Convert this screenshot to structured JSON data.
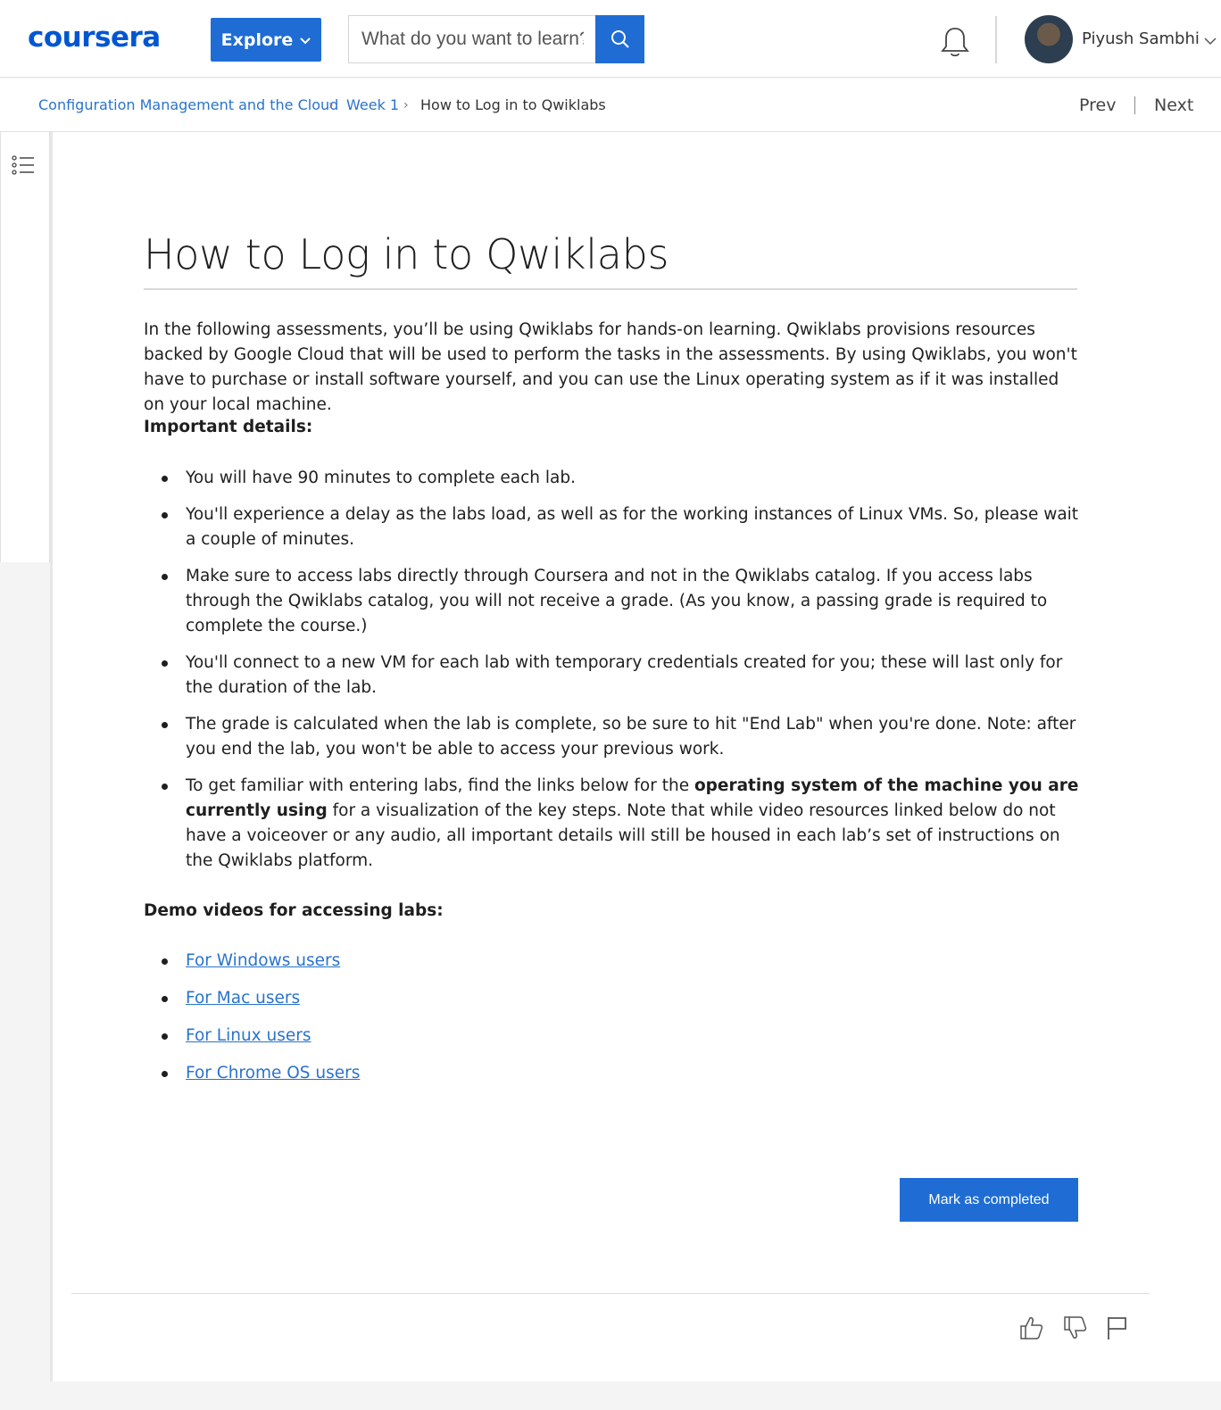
{
  "header": {
    "logo_text": "coursera",
    "explore_label": "Explore",
    "search_placeholder": "What do you want to learn?",
    "user_name": "Piyush Sambhi"
  },
  "breadcrumb": {
    "items": [
      "Configuration Management and the Cloud",
      "Week 1",
      "How to Log in to Qwiklabs"
    ],
    "prev_label": "Prev",
    "next_label": "Next"
  },
  "content": {
    "title": "How to Log in to Qwiklabs",
    "intro": "In the following assessments, you’ll be using Qwiklabs for hands-on learning. Qwiklabs provisions resources backed by Google Cloud that will be used to perform the tasks in the assessments. By using Qwiklabs, you won't have to purchase or install software yourself, and you can use the Linux operating system as if it was installed on your local machine.",
    "important_heading": "Important details:",
    "bullets": [
      "You will have 90 minutes to complete each lab.",
      "You'll experience a delay as the labs load, as well as for the working instances of Linux VMs. So, please wait a couple of minutes.",
      "Make sure to access labs directly through Coursera and not in the Qwiklabs catalog. If you access labs through the Qwiklabs catalog, you will not receive a grade. (As you know, a passing grade is required to complete the course.)",
      "You'll connect to a new VM for each lab with temporary credentials created for you; these will last only for the duration of the lab.",
      "The grade is calculated when the lab is complete, so be sure to hit \"End Lab\" when you're done. Note: after you end the lab, you won't be able to access your previous work."
    ],
    "last_bullet": {
      "before": "To get familiar with entering labs, find the links below for the ",
      "bold": "operating system of the machine you are currently using",
      "after": " for a visualization of the key steps. Note that while video resources linked below do not have a voiceover or any audio, all important details will still be housed in each lab’s set of instructions on the Qwiklabs platform."
    },
    "demo_heading": "Demo videos for accessing labs:",
    "links": [
      "For Windows users",
      "For Mac users",
      "For Linux users",
      "For Chrome OS users"
    ],
    "mark_completed_label": "Mark as completed"
  },
  "colors": {
    "brand_blue": "#0056d2",
    "button_blue": "#1f6dd4",
    "link_blue": "#2a73cc"
  }
}
